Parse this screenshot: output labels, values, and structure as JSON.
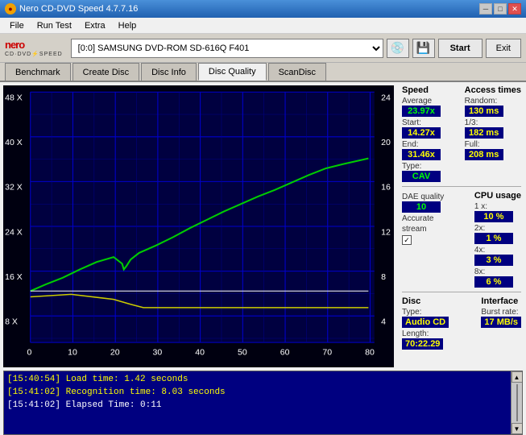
{
  "titleBar": {
    "icon": "●",
    "title": "Nero CD-DVD Speed 4.7.7.16",
    "minimize": "─",
    "maximize": "□",
    "close": "✕"
  },
  "menuBar": {
    "items": [
      "File",
      "Run Test",
      "Extra",
      "Help"
    ]
  },
  "toolbar": {
    "logoTop": "nero",
    "logoBottom": "CD·DVD⚡SPEED",
    "driveLabel": "[0:0]  SAMSUNG DVD-ROM SD-616Q F401",
    "startLabel": "Start",
    "exitLabel": "Exit"
  },
  "tabs": [
    {
      "label": "Benchmark",
      "active": false
    },
    {
      "label": "Create Disc",
      "active": false
    },
    {
      "label": "Disc Info",
      "active": false
    },
    {
      "label": "Disc Quality",
      "active": true
    },
    {
      "label": "ScanDisc",
      "active": false
    }
  ],
  "rightPanel": {
    "speedSection": {
      "title": "Speed",
      "averageLabel": "Average",
      "averageValue": "23.97x",
      "startLabel": "Start:",
      "startValue": "14.27x",
      "endLabel": "End:",
      "endValue": "31.46x",
      "typeLabel": "Type:",
      "typeValue": "CAV"
    },
    "accessTimesSection": {
      "title": "Access times",
      "randomLabel": "Random:",
      "randomValue": "130 ms",
      "oneThirdLabel": "1/3:",
      "oneThirdValue": "182 ms",
      "fullLabel": "Full:",
      "fullValue": "208 ms"
    },
    "daeSection": {
      "daeLabel": "DAE quality",
      "daeValue": "10",
      "accurateLabel": "Accurate",
      "streamLabel": "stream",
      "checkmark": "✓"
    },
    "cpuSection": {
      "title": "CPU usage",
      "cpu1xLabel": "1 x:",
      "cpu1xValue": "10 %",
      "cpu2xLabel": "2x:",
      "cpu2xValue": "1 %",
      "cpu4xLabel": "4x:",
      "cpu4xValue": "3 %",
      "cpu8xLabel": "8x:",
      "cpu8xValue": "6 %"
    },
    "discSection": {
      "title": "Disc",
      "typeLabel": "Type:",
      "typeValue": "Audio CD",
      "lengthLabel": "Length:",
      "lengthValue": "70:22.29"
    },
    "interfaceSection": {
      "title": "Interface",
      "burstLabel": "Burst rate:",
      "burstValue": "17 MB/s"
    }
  },
  "chart": {
    "leftAxisLabels": [
      "48 X",
      "40 X",
      "32 X",
      "24 X",
      "16 X",
      "8 X"
    ],
    "rightAxisLabels": [
      "24",
      "20",
      "16",
      "12",
      "8",
      "4"
    ],
    "bottomAxisLabels": [
      "0",
      "10",
      "20",
      "30",
      "40",
      "50",
      "60",
      "70",
      "80"
    ]
  },
  "log": {
    "lines": [
      {
        "time": "[15:40:54]",
        "text": " Load time: 1.42 seconds",
        "color": "yellow"
      },
      {
        "time": "[15:41:02]",
        "text": " Recognition time: 8.03 seconds",
        "color": "yellow"
      },
      {
        "time": "[15:41:02]",
        "text": " Elapsed Time: 0:11",
        "color": "white"
      }
    ]
  }
}
